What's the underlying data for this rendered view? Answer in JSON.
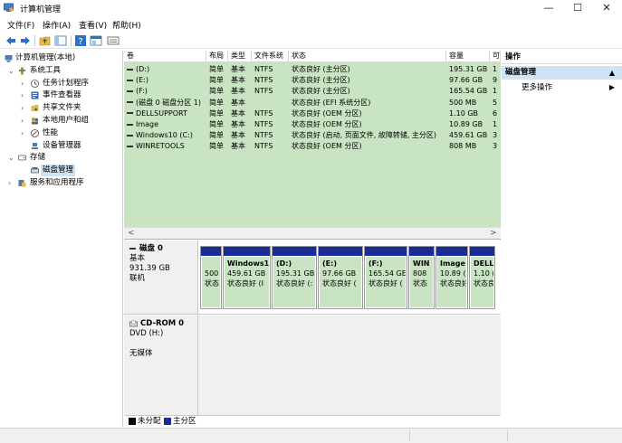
{
  "window": {
    "title": "计算机管理",
    "minimize": "—",
    "maximize": "☐",
    "close": "✕"
  },
  "menu": [
    "文件(F)",
    "操作(A)",
    "查看(V)",
    "帮助(H)"
  ],
  "toolbar": {
    "icons": [
      "back-icon",
      "forward-icon",
      "up-folder-icon",
      "console-tree-icon",
      "help-icon",
      "properties-icon",
      "view-icon"
    ]
  },
  "tree": {
    "root": "计算机管理(本地)",
    "system_tools": "系统工具",
    "task_scheduler": "任务计划程序",
    "event_viewer": "事件查看器",
    "shared_folders": "共享文件夹",
    "local_users": "本地用户和组",
    "performance": "性能",
    "device_manager": "设备管理器",
    "storage": "存储",
    "disk_management": "磁盘管理",
    "services": "服务和应用程序"
  },
  "volumes": {
    "headers": [
      "卷",
      "布局",
      "类型",
      "文件系统",
      "状态",
      "容量",
      "可"
    ],
    "rows": [
      {
        "name": "(D:)",
        "layout": "简单",
        "type": "基本",
        "fs": "NTFS",
        "status": "状态良好 (主分区)",
        "cap": "195.31 GB",
        "free": "1"
      },
      {
        "name": "(E:)",
        "layout": "简单",
        "type": "基本",
        "fs": "NTFS",
        "status": "状态良好 (主分区)",
        "cap": "97.66 GB",
        "free": "9"
      },
      {
        "name": "(F:)",
        "layout": "简单",
        "type": "基本",
        "fs": "NTFS",
        "status": "状态良好 (主分区)",
        "cap": "165.54 GB",
        "free": "1"
      },
      {
        "name": "(磁盘 0 磁盘分区 1)",
        "layout": "简单",
        "type": "基本",
        "fs": "",
        "status": "状态良好 (EFI 系统分区)",
        "cap": "500 MB",
        "free": "5"
      },
      {
        "name": "DELLSUPPORT",
        "layout": "简单",
        "type": "基本",
        "fs": "NTFS",
        "status": "状态良好 (OEM 分区)",
        "cap": "1.10 GB",
        "free": "6"
      },
      {
        "name": "Image",
        "layout": "简单",
        "type": "基本",
        "fs": "NTFS",
        "status": "状态良好 (OEM 分区)",
        "cap": "10.89 GB",
        "free": "1"
      },
      {
        "name": "Windows10 (C:)",
        "layout": "简单",
        "type": "基本",
        "fs": "NTFS",
        "status": "状态良好 (启动, 页面文件, 故障转储, 主分区)",
        "cap": "459.61 GB",
        "free": "3"
      },
      {
        "name": "WINRETOOLS",
        "layout": "简单",
        "type": "基本",
        "fs": "NTFS",
        "status": "状态良好 (OEM 分区)",
        "cap": "808 MB",
        "free": "3"
      }
    ],
    "scroll_left": "<",
    "scroll_right": ">"
  },
  "disk0": {
    "name": "磁盘 0",
    "type": "基本",
    "size": "931.39 GB",
    "state": "联机",
    "partitions": [
      {
        "name": "",
        "size": "500",
        "status": "状态"
      },
      {
        "name": "Windows1",
        "size": "459.61 GB",
        "status": "状态良好 (I"
      },
      {
        "name": "(D:)",
        "size": "195.31 GB",
        "status": "状态良好 (:"
      },
      {
        "name": "(E:)",
        "size": "97.66 GB",
        "status": "状态良好 ("
      },
      {
        "name": "(F:)",
        "size": "165.54 GE",
        "status": "状态良好 ("
      },
      {
        "name": "WIN",
        "size": "808",
        "status": "状态"
      },
      {
        "name": "Image",
        "size": "10.89 (",
        "status": "状态良好"
      },
      {
        "name": "DELL",
        "size": "1.10 (",
        "status": "状态良"
      }
    ]
  },
  "cdrom": {
    "name": "CD-ROM 0",
    "drive": "DVD (H:)",
    "media": "无媒体"
  },
  "legend": {
    "unallocated": "未分配",
    "primary": "主分区",
    "colors": {
      "unallocated": "#000000",
      "primary": "#1a2c92"
    }
  },
  "actions": {
    "header": "操作",
    "section": "磁盘管理",
    "section_arrow": "▲",
    "more": "更多操作",
    "more_arrow": "▶"
  },
  "colors": {
    "volume_bg": "#c9e4c2",
    "partition_bar": "#1a2c92",
    "selection": "#cce4f7"
  }
}
